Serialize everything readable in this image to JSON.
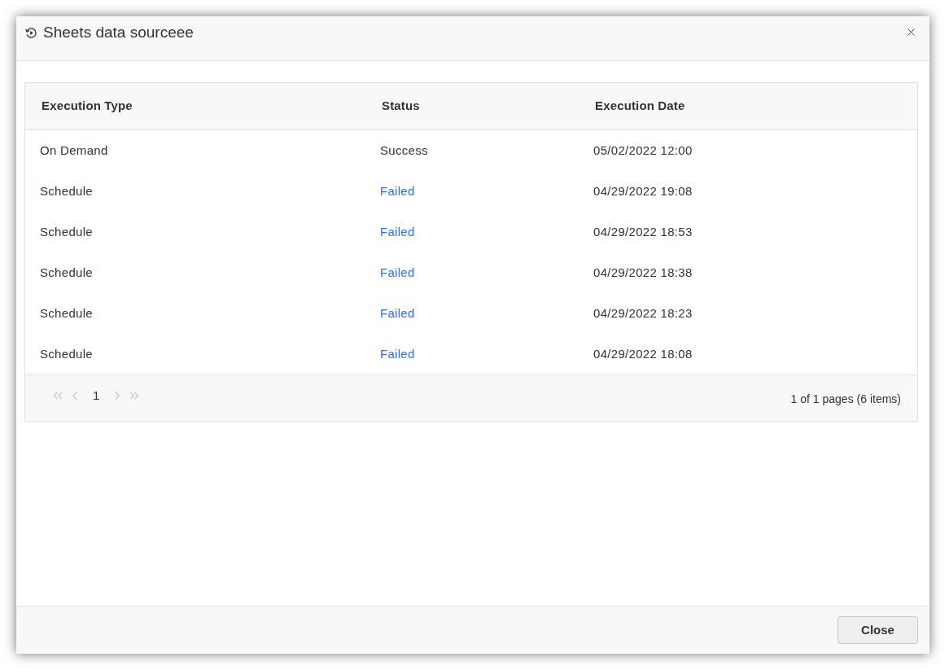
{
  "dialog": {
    "title": "Sheets data sourceee"
  },
  "table": {
    "columns": [
      "Execution Type",
      "Status",
      "Execution Date"
    ],
    "rows": [
      {
        "execution_type": "On Demand",
        "status": {
          "text": "Success",
          "kind": "success"
        },
        "execution_date": "05/02/2022 12:00"
      },
      {
        "execution_type": "Schedule",
        "status": {
          "text": "Failed",
          "kind": "failed"
        },
        "execution_date": "04/29/2022 19:08"
      },
      {
        "execution_type": "Schedule",
        "status": {
          "text": "Failed",
          "kind": "failed"
        },
        "execution_date": "04/29/2022 18:53"
      },
      {
        "execution_type": "Schedule",
        "status": {
          "text": "Failed",
          "kind": "failed"
        },
        "execution_date": "04/29/2022 18:38"
      },
      {
        "execution_type": "Schedule",
        "status": {
          "text": "Failed",
          "kind": "failed"
        },
        "execution_date": "04/29/2022 18:23"
      },
      {
        "execution_type": "Schedule",
        "status": {
          "text": "Failed",
          "kind": "failed"
        },
        "execution_date": "04/29/2022 18:08"
      }
    ]
  },
  "pager": {
    "nav_before": [
      {
        "kind": "first",
        "disabled": true
      },
      {
        "kind": "prev",
        "disabled": true
      }
    ],
    "pages": [
      {
        "label": "1",
        "selected": true
      }
    ],
    "nav_after": [
      {
        "kind": "next",
        "disabled": true
      },
      {
        "kind": "last",
        "disabled": true
      }
    ],
    "info": "1 of 1 pages (6 items)"
  },
  "footer": {
    "buttons": [
      "Close"
    ]
  }
}
